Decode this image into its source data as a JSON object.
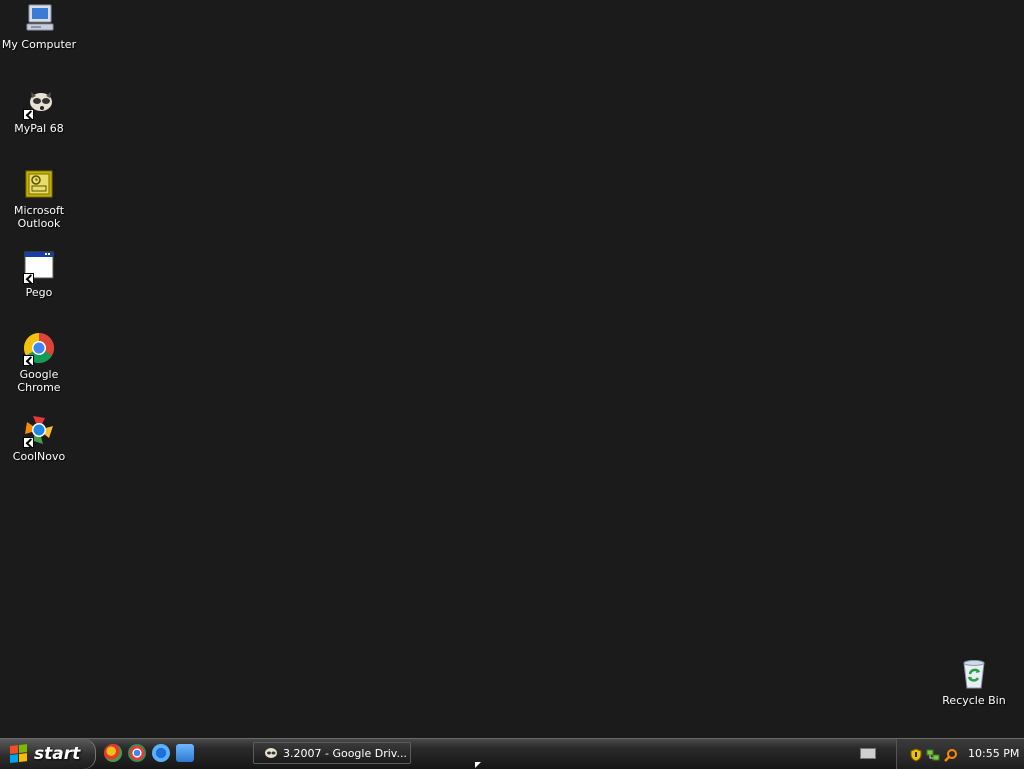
{
  "desktop": {
    "icons": [
      {
        "label": "My Computer",
        "icon": "my-computer-icon"
      },
      {
        "label": "MyPal 68",
        "icon": "mypal-icon"
      },
      {
        "label": "Microsoft\nOutlook",
        "icon": "outlook-icon"
      },
      {
        "label": "Pego",
        "icon": "application-window-icon"
      },
      {
        "label": "Google Chrome",
        "icon": "chrome-icon"
      },
      {
        "label": "CoolNovo",
        "icon": "coolnovo-icon"
      }
    ],
    "recycle_bin": {
      "label": "Recycle Bin",
      "icon": "recycle-bin-icon"
    }
  },
  "taskbar": {
    "start_label": "start",
    "quick_launch": [
      "mypal-icon",
      "chrome-icon",
      "internet-explorer-icon",
      "outlook-express-icon"
    ],
    "task_button": {
      "label": "3.2007 - Google Driv...",
      "icon": "mypal-icon"
    },
    "tray": {
      "icons": [
        "language-bar-keyboard-icon",
        "security-shield-icon",
        "network-icon",
        "search-icon"
      ],
      "clock": "10:55 PM"
    }
  },
  "colors": {
    "desktop_bg": "#1b1b1b",
    "taskbar": "#1e1e1e",
    "label_text": "#ffffff"
  }
}
